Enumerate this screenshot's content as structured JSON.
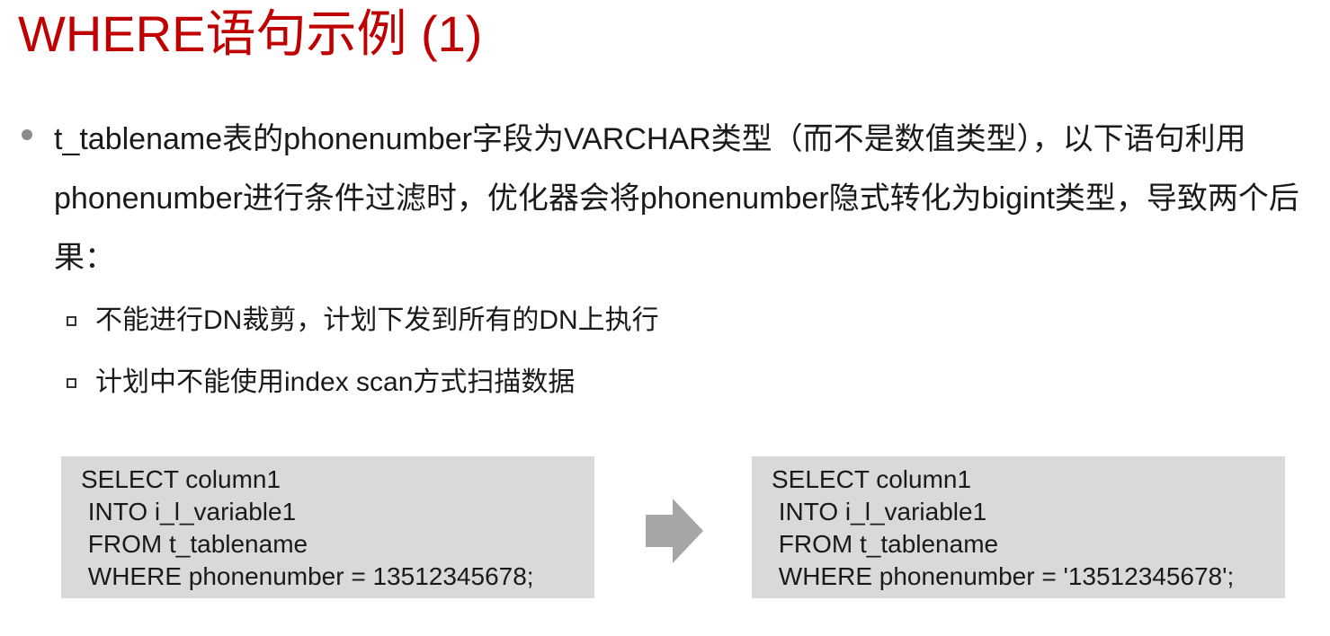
{
  "title": "WHERE语句示例 (1)",
  "bullet": {
    "text": "t_tablename表的phonenumber字段为VARCHAR类型（而不是数值类型），以下语句利用phonenumber进行条件过滤时，优化器会将phonenumber隐式转化为bigint类型，导致两个后果："
  },
  "consequences": [
    "不能进行DN裁剪，计划下发到所有的DN上执行",
    "计划中不能使用index scan方式扫描数据"
  ],
  "code_before": [
    "SELECT column1",
    " INTO i_l_variable1",
    " FROM t_tablename",
    " WHERE phonenumber = 13512345678;"
  ],
  "code_after": [
    "SELECT column1",
    " INTO i_l_variable1",
    " FROM t_tablename",
    " WHERE phonenumber = '13512345678';"
  ],
  "colors": {
    "title": "#c00000",
    "code_background": "#d9d9d9",
    "arrow": "#a6a6a6"
  },
  "icons": {
    "bullet": "filled-circle",
    "sub_bullet": "hollow-square",
    "transition": "right-arrow"
  }
}
